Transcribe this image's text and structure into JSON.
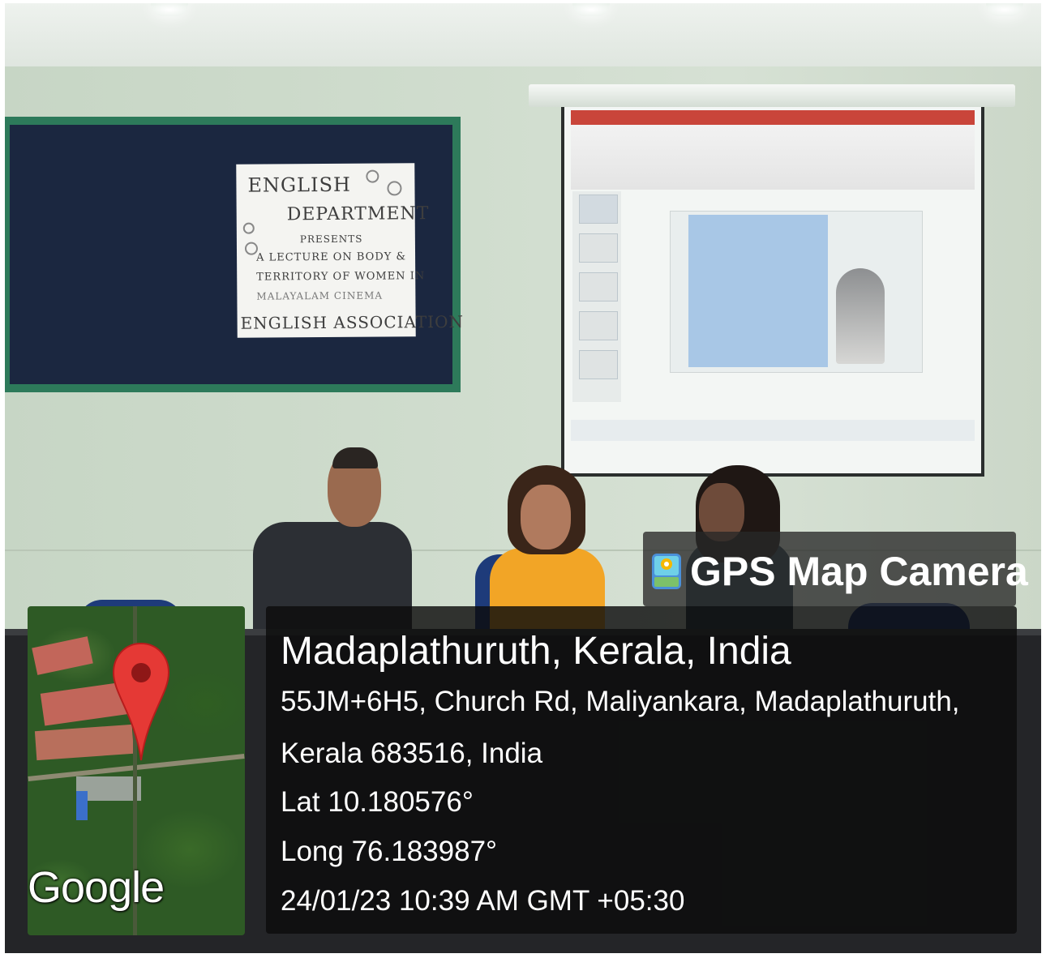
{
  "overlay": {
    "app_name": "GPS Map Camera",
    "location_title": "Madaplathuruth, Kerala, India",
    "address_line1": "55JM+6H5, Church Rd, Maliyankara, Madaplathuruth,",
    "address_line2": "Kerala 683516, India",
    "latitude": "Lat 10.180576°",
    "longitude": "Long 76.183987°",
    "datetime": "24/01/23 10:39 AM GMT +05:30"
  },
  "map": {
    "provider_label": "Google",
    "pin_icon": "map-pin-icon",
    "pin_color": "#e53935"
  },
  "poster": {
    "line1": "ENGLISH",
    "line2": "DEPARTMENT",
    "line3": "PRESENTS",
    "line4": "A LECTURE ON BODY &",
    "line5": "TERRITORY OF WOMEN IN",
    "line6": "MALAYALAM CINEMA",
    "line7": "ENGLISH ASSOCIATION"
  }
}
